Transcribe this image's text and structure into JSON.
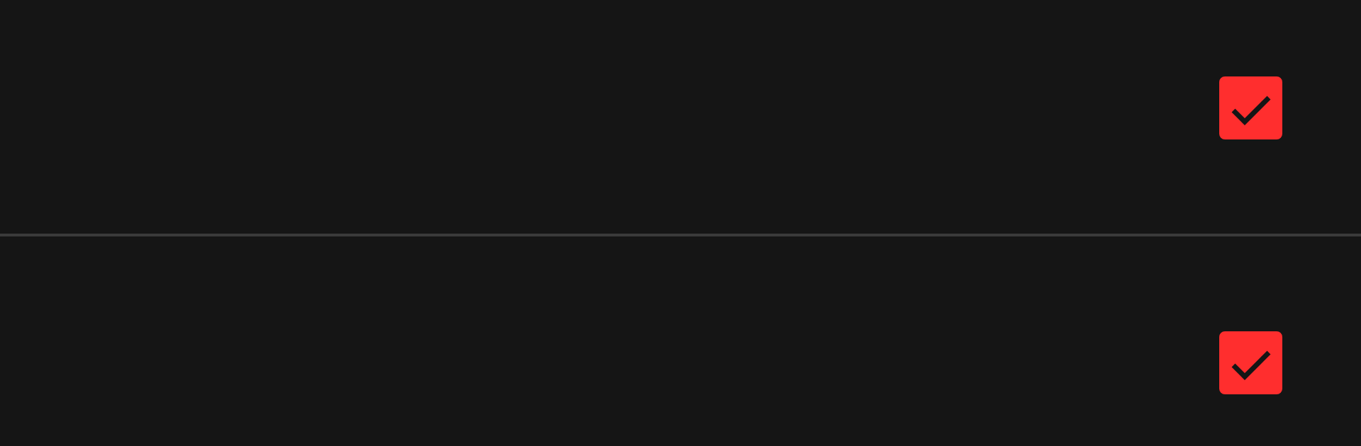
{
  "rows": [
    {
      "checked": true
    },
    {
      "checked": true
    }
  ]
}
